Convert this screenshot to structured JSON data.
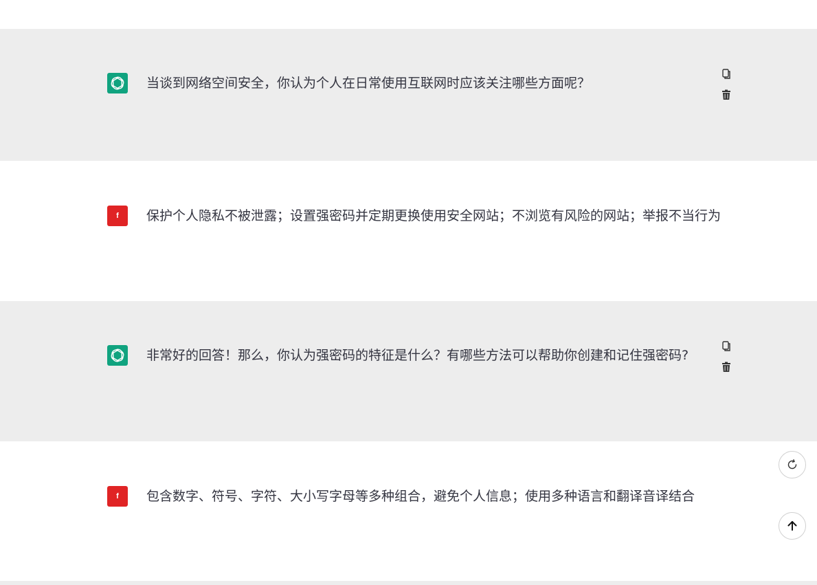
{
  "conversation": {
    "messages": [
      {
        "role": "assistant",
        "avatar_icon": "openai-logo-icon",
        "text": "当谈到网络空间安全，你认为个人在日常使用互联网时应该关注哪些方面呢？"
      },
      {
        "role": "user",
        "avatar_label": "f",
        "text": "保护个人隐私不被泄露；设置强密码并定期更换使用安全网站；不浏览有风险的网站；举报不当行为"
      },
      {
        "role": "assistant",
        "avatar_icon": "openai-logo-icon",
        "text": "非常好的回答！那么，你认为强密码的特征是什么？有哪些方法可以帮助你创建和记住强密码?"
      },
      {
        "role": "user",
        "avatar_label": "f",
        "text": "包含数字、符号、字符、大小写字母等多种组合，避免个人信息；使用多种语言和翻译音译结合"
      }
    ],
    "message_actions": [
      "copy-icon",
      "delete-icon"
    ]
  },
  "floating_buttons": {
    "regenerate_icon": "refresh-icon",
    "scroll_top_icon": "arrow-up-icon"
  },
  "colors": {
    "assistant_row_bg": "#ededed",
    "user_row_bg": "#ffffff",
    "assistant_avatar": "#10a37f",
    "user_avatar": "#e02425",
    "text": "#343541"
  }
}
